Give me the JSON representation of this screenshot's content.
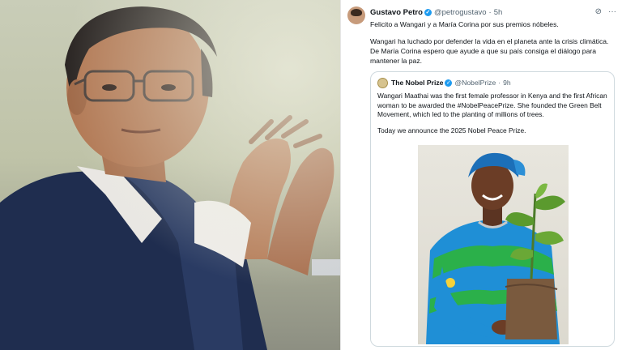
{
  "tweet": {
    "author_name": "Gustavo Petro",
    "author_handle": "@petrogustavo",
    "time": "5h",
    "paragraph1": "Felicito a Wangari y a María Corina por sus premios nóbeles.",
    "paragraph2": "Wangari ha luchado por defender la vida en el planeta ante la crisis climática. De María Corina espero que ayude a que su país consiga el diálogo para mantener la paz."
  },
  "quote": {
    "author_name": "The Nobel Prize",
    "author_handle": "@NobelPrize",
    "time": "9h",
    "paragraph1": "Wangari Maathai was the first female professor in Kenya and the first African woman to be awarded the #NobelPeacePrize. She founded the Green Belt Movement, which led to the planting of millions of trees.",
    "paragraph2": "Today we announce the 2025 Nobel Peace Prize."
  },
  "icons": {
    "verified": "verified-badge-icon",
    "grok": "grok-icon",
    "more": "more-icon"
  },
  "colors": {
    "verified": "#1d9bf0",
    "text": "#0f1419",
    "muted": "#536471",
    "border": "#cfd9de"
  }
}
